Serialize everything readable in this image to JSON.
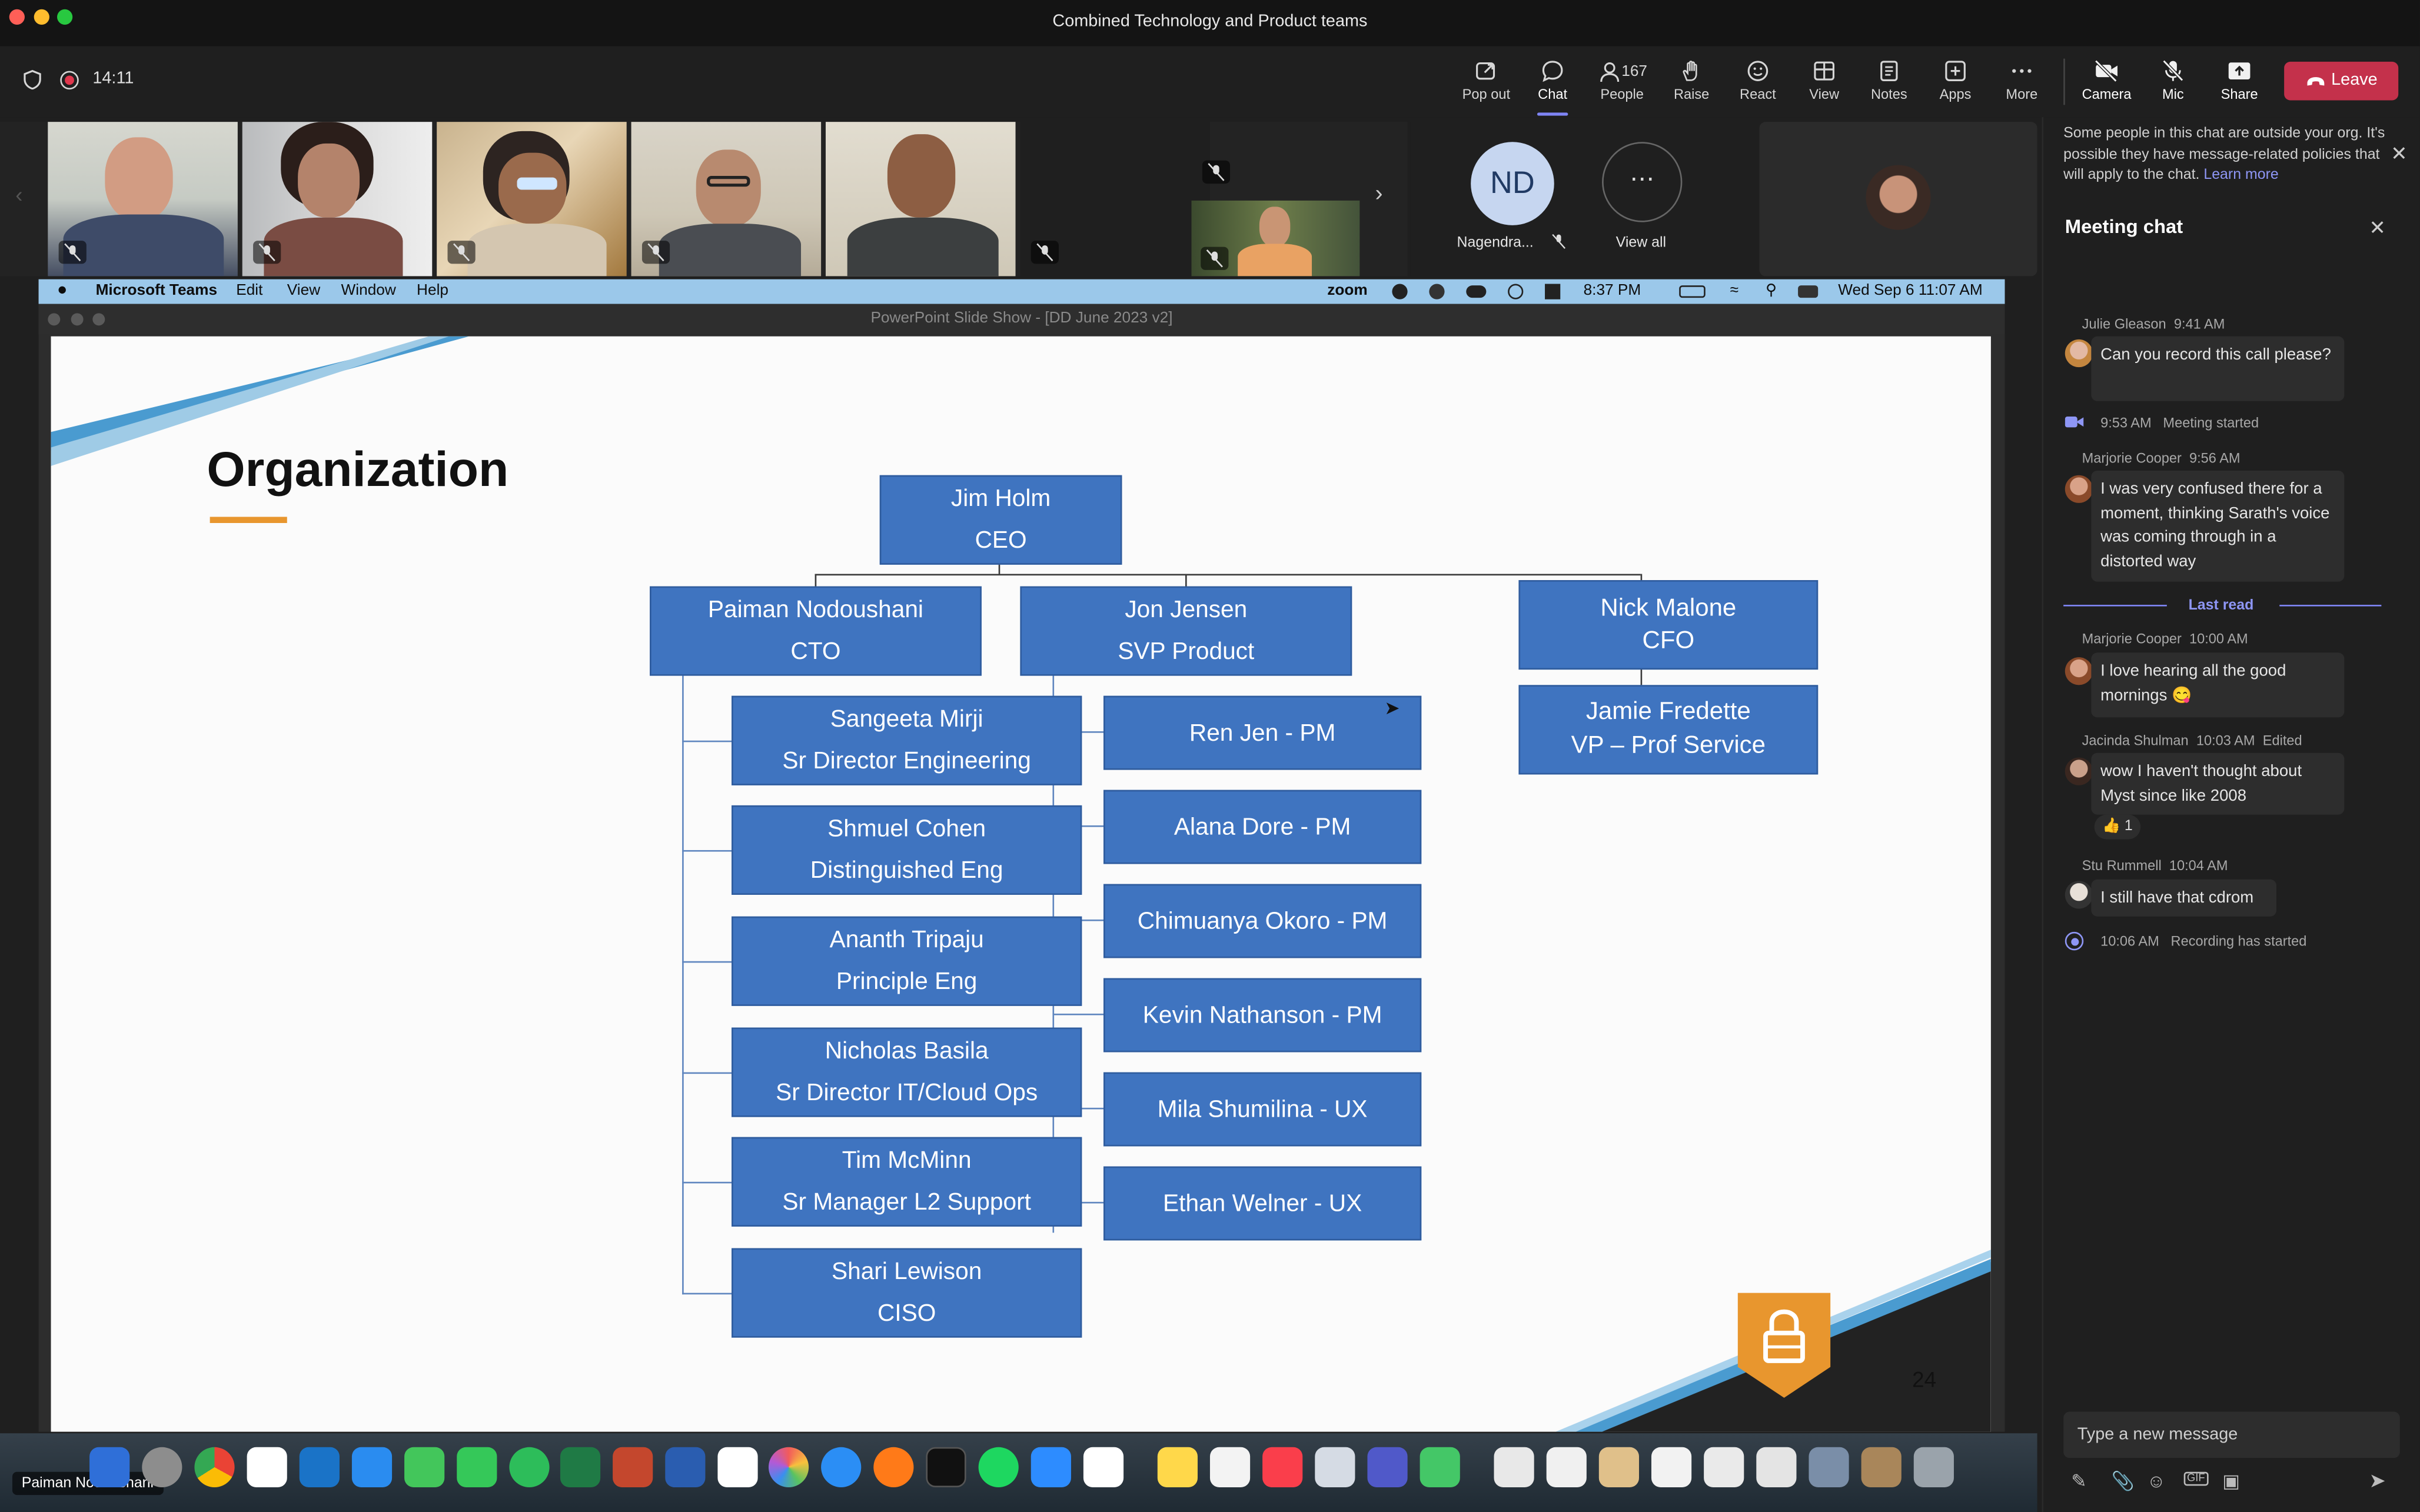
{
  "window": {
    "title": "Combined Technology and Product teams"
  },
  "meeting": {
    "timer": "14:11"
  },
  "toolbar": {
    "popout": "Pop out",
    "chat": "Chat",
    "people": "People",
    "people_count": "167",
    "raise": "Raise",
    "react": "React",
    "view": "View",
    "notes": "Notes",
    "apps": "Apps",
    "more": "More",
    "camera": "Camera",
    "mic": "Mic",
    "share": "Share",
    "leave": "Leave"
  },
  "gallery": {
    "nd_initials": "ND",
    "nd_name": "Nagendra...",
    "view_all": "View all",
    "presenter_name": "Paiman Nodoushani"
  },
  "shared_screen": {
    "mac_menu": [
      "Microsoft Teams",
      "Edit",
      "View",
      "Window",
      "Help"
    ],
    "mac_status": {
      "zoom": "zoom",
      "clock1": "8:37 PM",
      "datetime": "Wed Sep 6  11:07 AM"
    },
    "ppt_title": "PowerPoint Slide Show - [DD June 2023 v2]",
    "slide": {
      "title": "Organization",
      "page_number": "24",
      "ceo": {
        "name": "Jim Holm",
        "role": "CEO"
      },
      "cto": {
        "name": "Paiman Nodoushani",
        "role": "CTO"
      },
      "svp": {
        "name": "Jon Jensen",
        "role": "SVP Product"
      },
      "cfo": {
        "name": "Nick Malone",
        "role": "CFO"
      },
      "vp": {
        "name": "Jamie Fredette",
        "role": "VP – Prof Service"
      },
      "eng": [
        {
          "name": "Sangeeta Mirji",
          "role": "Sr Director Engineering"
        },
        {
          "name": "Shmuel Cohen",
          "role": "Distinguished Eng"
        },
        {
          "name": "Ananth Tripaju",
          "role": "Principle Eng"
        },
        {
          "name": "Nicholas Basila",
          "role": "Sr Director IT/Cloud Ops"
        },
        {
          "name": "Tim McMinn",
          "role": "Sr Manager L2 Support"
        },
        {
          "name": "Shari Lewison",
          "role": "CISO"
        }
      ],
      "product": [
        "Ren Jen - PM",
        "Alana Dore - PM",
        "Chimuanya Okoro - PM",
        "Kevin Nathanson - PM",
        "Mila Shumilina - UX",
        "Ethan Welner - UX"
      ]
    }
  },
  "chat": {
    "banner": "Some people in this chat are outside your org. It's possible they have message-related policies that will apply to the chat.",
    "banner_link": "Learn more",
    "title": "Meeting chat",
    "last_read": "Last read",
    "compose_placeholder": "Type a new message",
    "messages": [
      {
        "author": "Julie Gleason",
        "time": "9:41 AM",
        "text": "Can you record this call please?"
      },
      {
        "author": "Marjorie Cooper",
        "time": "9:56 AM",
        "text": "I was very confused there for a moment, thinking Sarath's voice was coming through in a distorted way"
      },
      {
        "author": "Marjorie Cooper",
        "time": "10:00 AM",
        "text": "I love hearing all the good mornings 😋"
      },
      {
        "author": "Jacinda Shulman",
        "time": "10:03 AM",
        "edited": "Edited",
        "text": "wow I haven't thought about Myst since like 2008",
        "reaction": "👍 1"
      },
      {
        "author": "Stu Rummell",
        "time": "10:04 AM",
        "text": "I still have that cdrom"
      }
    ],
    "events": [
      {
        "time": "9:53 AM",
        "text": "Meeting started"
      },
      {
        "time": "10:06 AM",
        "text": "Recording has started"
      }
    ]
  }
}
